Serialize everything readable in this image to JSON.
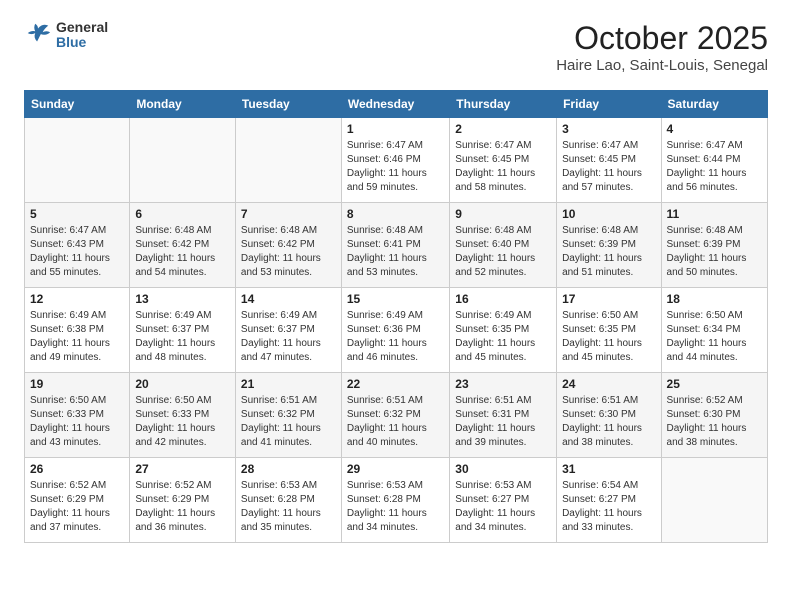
{
  "header": {
    "logo_general": "General",
    "logo_blue": "Blue",
    "month_title": "October 2025",
    "subtitle": "Haire Lao, Saint-Louis, Senegal"
  },
  "weekdays": [
    "Sunday",
    "Monday",
    "Tuesday",
    "Wednesday",
    "Thursday",
    "Friday",
    "Saturday"
  ],
  "weeks": [
    [
      {
        "day": "",
        "info": ""
      },
      {
        "day": "",
        "info": ""
      },
      {
        "day": "",
        "info": ""
      },
      {
        "day": "1",
        "info": "Sunrise: 6:47 AM\nSunset: 6:46 PM\nDaylight: 11 hours\nand 59 minutes."
      },
      {
        "day": "2",
        "info": "Sunrise: 6:47 AM\nSunset: 6:45 PM\nDaylight: 11 hours\nand 58 minutes."
      },
      {
        "day": "3",
        "info": "Sunrise: 6:47 AM\nSunset: 6:45 PM\nDaylight: 11 hours\nand 57 minutes."
      },
      {
        "day": "4",
        "info": "Sunrise: 6:47 AM\nSunset: 6:44 PM\nDaylight: 11 hours\nand 56 minutes."
      }
    ],
    [
      {
        "day": "5",
        "info": "Sunrise: 6:47 AM\nSunset: 6:43 PM\nDaylight: 11 hours\nand 55 minutes."
      },
      {
        "day": "6",
        "info": "Sunrise: 6:48 AM\nSunset: 6:42 PM\nDaylight: 11 hours\nand 54 minutes."
      },
      {
        "day": "7",
        "info": "Sunrise: 6:48 AM\nSunset: 6:42 PM\nDaylight: 11 hours\nand 53 minutes."
      },
      {
        "day": "8",
        "info": "Sunrise: 6:48 AM\nSunset: 6:41 PM\nDaylight: 11 hours\nand 53 minutes."
      },
      {
        "day": "9",
        "info": "Sunrise: 6:48 AM\nSunset: 6:40 PM\nDaylight: 11 hours\nand 52 minutes."
      },
      {
        "day": "10",
        "info": "Sunrise: 6:48 AM\nSunset: 6:39 PM\nDaylight: 11 hours\nand 51 minutes."
      },
      {
        "day": "11",
        "info": "Sunrise: 6:48 AM\nSunset: 6:39 PM\nDaylight: 11 hours\nand 50 minutes."
      }
    ],
    [
      {
        "day": "12",
        "info": "Sunrise: 6:49 AM\nSunset: 6:38 PM\nDaylight: 11 hours\nand 49 minutes."
      },
      {
        "day": "13",
        "info": "Sunrise: 6:49 AM\nSunset: 6:37 PM\nDaylight: 11 hours\nand 48 minutes."
      },
      {
        "day": "14",
        "info": "Sunrise: 6:49 AM\nSunset: 6:37 PM\nDaylight: 11 hours\nand 47 minutes."
      },
      {
        "day": "15",
        "info": "Sunrise: 6:49 AM\nSunset: 6:36 PM\nDaylight: 11 hours\nand 46 minutes."
      },
      {
        "day": "16",
        "info": "Sunrise: 6:49 AM\nSunset: 6:35 PM\nDaylight: 11 hours\nand 45 minutes."
      },
      {
        "day": "17",
        "info": "Sunrise: 6:50 AM\nSunset: 6:35 PM\nDaylight: 11 hours\nand 45 minutes."
      },
      {
        "day": "18",
        "info": "Sunrise: 6:50 AM\nSunset: 6:34 PM\nDaylight: 11 hours\nand 44 minutes."
      }
    ],
    [
      {
        "day": "19",
        "info": "Sunrise: 6:50 AM\nSunset: 6:33 PM\nDaylight: 11 hours\nand 43 minutes."
      },
      {
        "day": "20",
        "info": "Sunrise: 6:50 AM\nSunset: 6:33 PM\nDaylight: 11 hours\nand 42 minutes."
      },
      {
        "day": "21",
        "info": "Sunrise: 6:51 AM\nSunset: 6:32 PM\nDaylight: 11 hours\nand 41 minutes."
      },
      {
        "day": "22",
        "info": "Sunrise: 6:51 AM\nSunset: 6:32 PM\nDaylight: 11 hours\nand 40 minutes."
      },
      {
        "day": "23",
        "info": "Sunrise: 6:51 AM\nSunset: 6:31 PM\nDaylight: 11 hours\nand 39 minutes."
      },
      {
        "day": "24",
        "info": "Sunrise: 6:51 AM\nSunset: 6:30 PM\nDaylight: 11 hours\nand 38 minutes."
      },
      {
        "day": "25",
        "info": "Sunrise: 6:52 AM\nSunset: 6:30 PM\nDaylight: 11 hours\nand 38 minutes."
      }
    ],
    [
      {
        "day": "26",
        "info": "Sunrise: 6:52 AM\nSunset: 6:29 PM\nDaylight: 11 hours\nand 37 minutes."
      },
      {
        "day": "27",
        "info": "Sunrise: 6:52 AM\nSunset: 6:29 PM\nDaylight: 11 hours\nand 36 minutes."
      },
      {
        "day": "28",
        "info": "Sunrise: 6:53 AM\nSunset: 6:28 PM\nDaylight: 11 hours\nand 35 minutes."
      },
      {
        "day": "29",
        "info": "Sunrise: 6:53 AM\nSunset: 6:28 PM\nDaylight: 11 hours\nand 34 minutes."
      },
      {
        "day": "30",
        "info": "Sunrise: 6:53 AM\nSunset: 6:27 PM\nDaylight: 11 hours\nand 34 minutes."
      },
      {
        "day": "31",
        "info": "Sunrise: 6:54 AM\nSunset: 6:27 PM\nDaylight: 11 hours\nand 33 minutes."
      },
      {
        "day": "",
        "info": ""
      }
    ]
  ]
}
